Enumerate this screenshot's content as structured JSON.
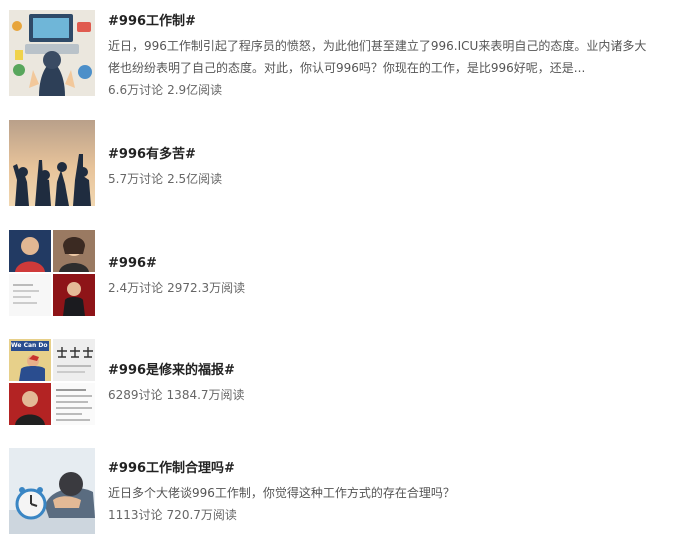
{
  "topics": [
    {
      "title": "#996工作制#",
      "description": "近日，996工作制引起了程序员的愤怒，为此他们甚至建立了996.ICU来表明自己的态度。业内诸多大佬也纷纷表明了自己的态度。对此，你认可996吗？你现在的工作，是比996好呢，还是...",
      "discussions": "6.6万讨论",
      "reads": "2.9亿阅读"
    },
    {
      "title": "#996有多苦#",
      "description": "",
      "discussions": "5.7万讨论",
      "reads": "2.5亿阅读"
    },
    {
      "title": "#996#",
      "description": "",
      "discussions": "2.4万讨论",
      "reads": "2972.3万阅读"
    },
    {
      "title": "#996是修来的福报#",
      "description": "",
      "discussions": "6289讨论",
      "reads": "1384.7万阅读",
      "thumb_text": "We Can Do It!"
    },
    {
      "title": "#996工作制合理吗#",
      "description": "近日多个大佬谈996工作制，你觉得这种工作方式的存在合理吗？",
      "discussions": "1113讨论",
      "reads": "720.7万阅读"
    }
  ]
}
